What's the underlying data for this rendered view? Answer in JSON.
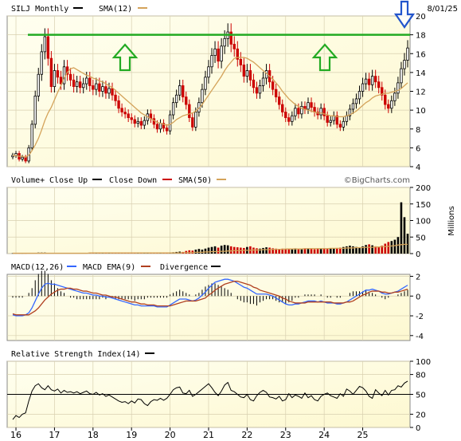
{
  "header": {
    "symbol_label": "SILJ Monthly",
    "sma_label": "SMA(12)",
    "date_label": "8/01/25"
  },
  "volume_header": {
    "title": "Volume+",
    "close_up_label": "Close Up",
    "close_down_label": "Close Down",
    "sma_label": "SMA(50)",
    "watermark": "©BigCharts.com",
    "unit_label": "Millions"
  },
  "macd_header": {
    "title": "MACD(12,26)",
    "ema_label": "MACD EMA(9)",
    "divergence_label": "Divergence"
  },
  "rsi_header": {
    "title": "Relative Strength Index(14)"
  },
  "colors": {
    "up": "#000000",
    "down": "#cc0000",
    "sma": "#d4a35a",
    "macd": "#3366ff",
    "macd_ema": "#b04020",
    "resistance": "#22aa22",
    "arrow_green": "#22aa22",
    "arrow_blue": "#2255cc",
    "panel_bg": "#fffde0",
    "grid": "#d8d0b0"
  },
  "chart_data": [
    {
      "type": "candlestick",
      "title": "SILJ Monthly",
      "x_tick_labels": [
        "16",
        "17",
        "18",
        "19",
        "20",
        "21",
        "22",
        "23",
        "24",
        "25"
      ],
      "y_ticks": [
        4,
        6,
        8,
        10,
        12,
        14,
        16,
        18,
        20
      ],
      "ylim": [
        4,
        20
      ],
      "resistance_level": 18,
      "annotations": [
        "green-up-arrow",
        "green-up-arrow",
        "blue-down-arrow"
      ],
      "series": [
        {
          "name": "SILJ Monthly",
          "closes": [
            5.2,
            5.4,
            4.8,
            5.0,
            4.6,
            6.0,
            8.5,
            11.5,
            13.8,
            16.2,
            17.8,
            15.5,
            12.5,
            14.2,
            13.5,
            12.8,
            14.6,
            13.8,
            13.2,
            12.5,
            13.0,
            12.4,
            12.8,
            13.4,
            12.6,
            12.2,
            12.8,
            12.0,
            12.5,
            11.8,
            12.3,
            11.6,
            11.0,
            10.2,
            9.8,
            9.6,
            9.2,
            9.0,
            8.6,
            8.8,
            8.4,
            8.9,
            9.6,
            9.1,
            8.5,
            8.0,
            8.6,
            8.1,
            7.8,
            9.5,
            10.8,
            11.6,
            12.6,
            11.4,
            10.6,
            9.2,
            8.2,
            9.8,
            10.8,
            12.2,
            13.5,
            14.6,
            15.8,
            16.5,
            15.2,
            16.8,
            17.6,
            18.3,
            17.0,
            16.5,
            15.4,
            14.8,
            13.6,
            14.2,
            13.2,
            12.4,
            11.8,
            12.6,
            13.4,
            14.2,
            13.0,
            12.2,
            11.4,
            10.6,
            9.8,
            9.2,
            8.8,
            9.4,
            10.2,
            9.6,
            10.4,
            10.1,
            10.8,
            10.3,
            9.8,
            9.5,
            10.2,
            9.4,
            8.7,
            8.9,
            9.4,
            8.5,
            8.2,
            8.8,
            9.4,
            10.1,
            10.7,
            11.2,
            12.0,
            12.8,
            13.3,
            12.7,
            13.6,
            13.0,
            12.4,
            11.6,
            10.6,
            10.2,
            11.0,
            11.8,
            12.9,
            14.4,
            15.3,
            16.6
          ]
        },
        {
          "name": "SMA(12)",
          "values": [
            5.2,
            5.2,
            5.1,
            5.1,
            5.0,
            5.2,
            5.7,
            6.3,
            7.0,
            7.9,
            8.9,
            9.7,
            10.3,
            11.1,
            11.9,
            12.6,
            13.4,
            14.0,
            14.4,
            14.5,
            14.3,
            14.1,
            13.9,
            13.7,
            13.6,
            13.4,
            13.3,
            13.1,
            13.0,
            12.8,
            12.6,
            12.4,
            12.1,
            11.8,
            11.5,
            11.2,
            10.9,
            10.6,
            10.3,
            10.0,
            9.7,
            9.5,
            9.3,
            9.1,
            8.9,
            8.7,
            8.6,
            8.5,
            8.4,
            8.5,
            8.7,
            9.0,
            9.2,
            9.4,
            9.5,
            9.6,
            9.7,
            9.9,
            10.2,
            10.6,
            11.1,
            11.6,
            12.1,
            12.6,
            13.1,
            13.6,
            14.2,
            14.7,
            15.1,
            15.5,
            15.6,
            15.6,
            15.6,
            15.5,
            15.3,
            15.1,
            14.8,
            14.5,
            14.2,
            13.9,
            13.6,
            13.3,
            12.9,
            12.5,
            12.0,
            11.6,
            11.2,
            10.9,
            10.6,
            10.4,
            10.2,
            10.1,
            10.0,
            9.9,
            9.8,
            9.7,
            9.7,
            9.6,
            9.5,
            9.4,
            9.4,
            9.3,
            9.3,
            9.3,
            9.4,
            9.5,
            9.7,
            9.9,
            10.2,
            10.5,
            10.8,
            11.0,
            11.3,
            11.5,
            11.6,
            11.7,
            11.8,
            11.8,
            11.9,
            12.0,
            12.1,
            12.3,
            12.6,
            12.9
          ]
        }
      ]
    },
    {
      "type": "bar",
      "title": "Volume+",
      "y_ticks": [
        0,
        50,
        100,
        150,
        200
      ],
      "ylim": [
        0,
        200
      ],
      "ylabel": "Millions",
      "series": [
        {
          "name": "Volume+",
          "values": [
            1,
            1,
            1,
            1,
            1,
            2,
            2,
            2,
            3,
            3,
            3,
            2,
            2,
            2,
            2,
            2,
            2,
            2,
            2,
            2,
            2,
            2,
            2,
            2,
            2,
            2,
            2,
            2,
            2,
            2,
            2,
            2,
            2,
            2,
            2,
            2,
            2,
            2,
            2,
            2,
            2,
            2,
            2,
            2,
            2,
            2,
            2,
            2,
            2,
            3,
            4,
            5,
            6,
            5,
            8,
            10,
            9,
            12,
            14,
            12,
            15,
            18,
            20,
            22,
            18,
            24,
            26,
            25,
            22,
            20,
            19,
            18,
            17,
            20,
            22,
            18,
            16,
            15,
            17,
            19,
            18,
            16,
            15,
            14,
            15,
            13,
            14,
            15,
            16,
            14,
            15,
            16,
            15,
            14,
            13,
            14,
            15,
            16,
            14,
            15,
            16,
            17,
            18,
            20,
            22,
            24,
            22,
            20,
            18,
            22,
            26,
            28,
            25,
            22,
            20,
            24,
            30,
            35,
            38,
            42,
            50,
            155,
            110,
            60
          ]
        },
        {
          "name": "SMA(50)",
          "values": [
            1,
            1,
            1,
            1,
            1,
            1,
            1,
            1,
            1,
            1,
            1,
            1,
            1,
            1,
            1,
            1,
            1,
            1,
            1,
            1,
            1,
            1,
            1,
            1,
            2,
            2,
            2,
            2,
            2,
            2,
            2,
            2,
            2,
            2,
            2,
            2,
            2,
            2,
            2,
            2,
            2,
            2,
            2,
            2,
            2,
            2,
            2,
            2,
            2,
            2,
            2,
            2,
            2,
            3,
            3,
            3,
            3,
            4,
            4,
            4,
            5,
            5,
            6,
            6,
            6,
            7,
            7,
            8,
            8,
            9,
            9,
            9,
            10,
            10,
            10,
            11,
            11,
            11,
            12,
            12,
            12,
            13,
            13,
            13,
            13,
            14,
            14,
            14,
            14,
            14,
            14,
            15,
            15,
            15,
            15,
            15,
            15,
            15,
            15,
            16,
            16,
            16,
            16,
            16,
            17,
            17,
            17,
            18,
            18,
            18,
            19,
            19,
            19,
            20,
            20,
            21,
            21,
            22,
            23,
            24,
            26,
            27,
            28,
            28
          ]
        }
      ]
    },
    {
      "type": "line",
      "title": "MACD(12,26)",
      "y_ticks": [
        -4,
        -2,
        0,
        2
      ],
      "ylim": [
        -4.5,
        2.2
      ],
      "series": [
        {
          "name": "MACD(12,26)",
          "values": [
            -1.9,
            -2.0,
            -2.0,
            -2.0,
            -1.9,
            -1.7,
            -1.2,
            -0.5,
            0.2,
            0.8,
            1.2,
            1.3,
            1.2,
            1.2,
            1.1,
            1.0,
            0.9,
            0.8,
            0.7,
            0.6,
            0.5,
            0.4,
            0.3,
            0.3,
            0.2,
            0.1,
            0.1,
            0.0,
            0.0,
            -0.1,
            -0.1,
            -0.2,
            -0.3,
            -0.4,
            -0.5,
            -0.6,
            -0.7,
            -0.8,
            -0.9,
            -0.9,
            -1.0,
            -1.0,
            -1.0,
            -1.0,
            -1.0,
            -1.1,
            -1.1,
            -1.1,
            -1.1,
            -0.9,
            -0.7,
            -0.5,
            -0.3,
            -0.3,
            -0.3,
            -0.4,
            -0.5,
            -0.4,
            -0.2,
            0.1,
            0.4,
            0.8,
            1.1,
            1.4,
            1.5,
            1.6,
            1.7,
            1.7,
            1.6,
            1.5,
            1.3,
            1.1,
            0.9,
            0.8,
            0.6,
            0.4,
            0.2,
            0.2,
            0.2,
            0.2,
            0.1,
            0.0,
            -0.2,
            -0.4,
            -0.6,
            -0.8,
            -0.9,
            -0.9,
            -0.8,
            -0.8,
            -0.7,
            -0.6,
            -0.5,
            -0.5,
            -0.5,
            -0.6,
            -0.5,
            -0.6,
            -0.7,
            -0.7,
            -0.7,
            -0.8,
            -0.8,
            -0.7,
            -0.6,
            -0.4,
            -0.2,
            0.0,
            0.2,
            0.4,
            0.6,
            0.6,
            0.7,
            0.6,
            0.5,
            0.3,
            0.2,
            0.2,
            0.3,
            0.4,
            0.5,
            0.7,
            0.9,
            1.1
          ]
        },
        {
          "name": "MACD EMA(9)",
          "values": [
            -1.8,
            -1.9,
            -1.9,
            -1.9,
            -1.9,
            -1.9,
            -1.7,
            -1.5,
            -1.2,
            -0.8,
            -0.4,
            -0.1,
            0.2,
            0.4,
            0.6,
            0.7,
            0.7,
            0.8,
            0.8,
            0.7,
            0.7,
            0.6,
            0.5,
            0.5,
            0.4,
            0.3,
            0.3,
            0.2,
            0.1,
            0.1,
            0.0,
            -0.1,
            -0.1,
            -0.2,
            -0.3,
            -0.4,
            -0.5,
            -0.6,
            -0.6,
            -0.7,
            -0.8,
            -0.8,
            -0.9,
            -0.9,
            -0.9,
            -1.0,
            -1.0,
            -1.0,
            -1.0,
            -1.0,
            -0.9,
            -0.8,
            -0.7,
            -0.6,
            -0.5,
            -0.5,
            -0.5,
            -0.5,
            -0.4,
            -0.3,
            -0.2,
            0.1,
            0.3,
            0.6,
            0.8,
            1.0,
            1.2,
            1.3,
            1.4,
            1.5,
            1.5,
            1.4,
            1.3,
            1.2,
            1.1,
            0.9,
            0.8,
            0.6,
            0.5,
            0.4,
            0.3,
            0.2,
            0.1,
            0.0,
            -0.2,
            -0.3,
            -0.5,
            -0.6,
            -0.7,
            -0.7,
            -0.7,
            -0.7,
            -0.6,
            -0.6,
            -0.6,
            -0.6,
            -0.6,
            -0.6,
            -0.6,
            -0.6,
            -0.7,
            -0.7,
            -0.7,
            -0.7,
            -0.6,
            -0.6,
            -0.5,
            -0.3,
            -0.1,
            0.1,
            0.2,
            0.4,
            0.5,
            0.5,
            0.5,
            0.4,
            0.4,
            0.3,
            0.3,
            0.4,
            0.4,
            0.5,
            0.6,
            0.7
          ]
        }
      ]
    },
    {
      "type": "line",
      "title": "Relative Strength Index(14)",
      "y_ticks": [
        0,
        20,
        50,
        80,
        100
      ],
      "ylim": [
        0,
        100
      ],
      "reference_level": 50,
      "series": [
        {
          "name": "Relative Strength Index(14)",
          "values": [
            12,
            18,
            15,
            20,
            22,
            40,
            55,
            63,
            66,
            60,
            57,
            63,
            57,
            55,
            58,
            52,
            56,
            53,
            54,
            52,
            54,
            51,
            53,
            55,
            51,
            50,
            53,
            49,
            51,
            47,
            49,
            46,
            43,
            40,
            38,
            39,
            36,
            40,
            37,
            43,
            42,
            36,
            33,
            39,
            42,
            41,
            44,
            41,
            44,
            50,
            57,
            60,
            61,
            52,
            51,
            56,
            47,
            50,
            54,
            58,
            62,
            66,
            60,
            53,
            48,
            55,
            64,
            68,
            56,
            54,
            50,
            46,
            45,
            50,
            42,
            40,
            48,
            53,
            56,
            53,
            46,
            45,
            43,
            47,
            40,
            42,
            51,
            45,
            49,
            47,
            44,
            52,
            45,
            48,
            42,
            40,
            47,
            50,
            52,
            48,
            46,
            44,
            51,
            47,
            58,
            55,
            50,
            56,
            62,
            60,
            55,
            47,
            44,
            57,
            52,
            48,
            56,
            49,
            56,
            57,
            63,
            61,
            67,
            70
          ]
        }
      ]
    }
  ]
}
